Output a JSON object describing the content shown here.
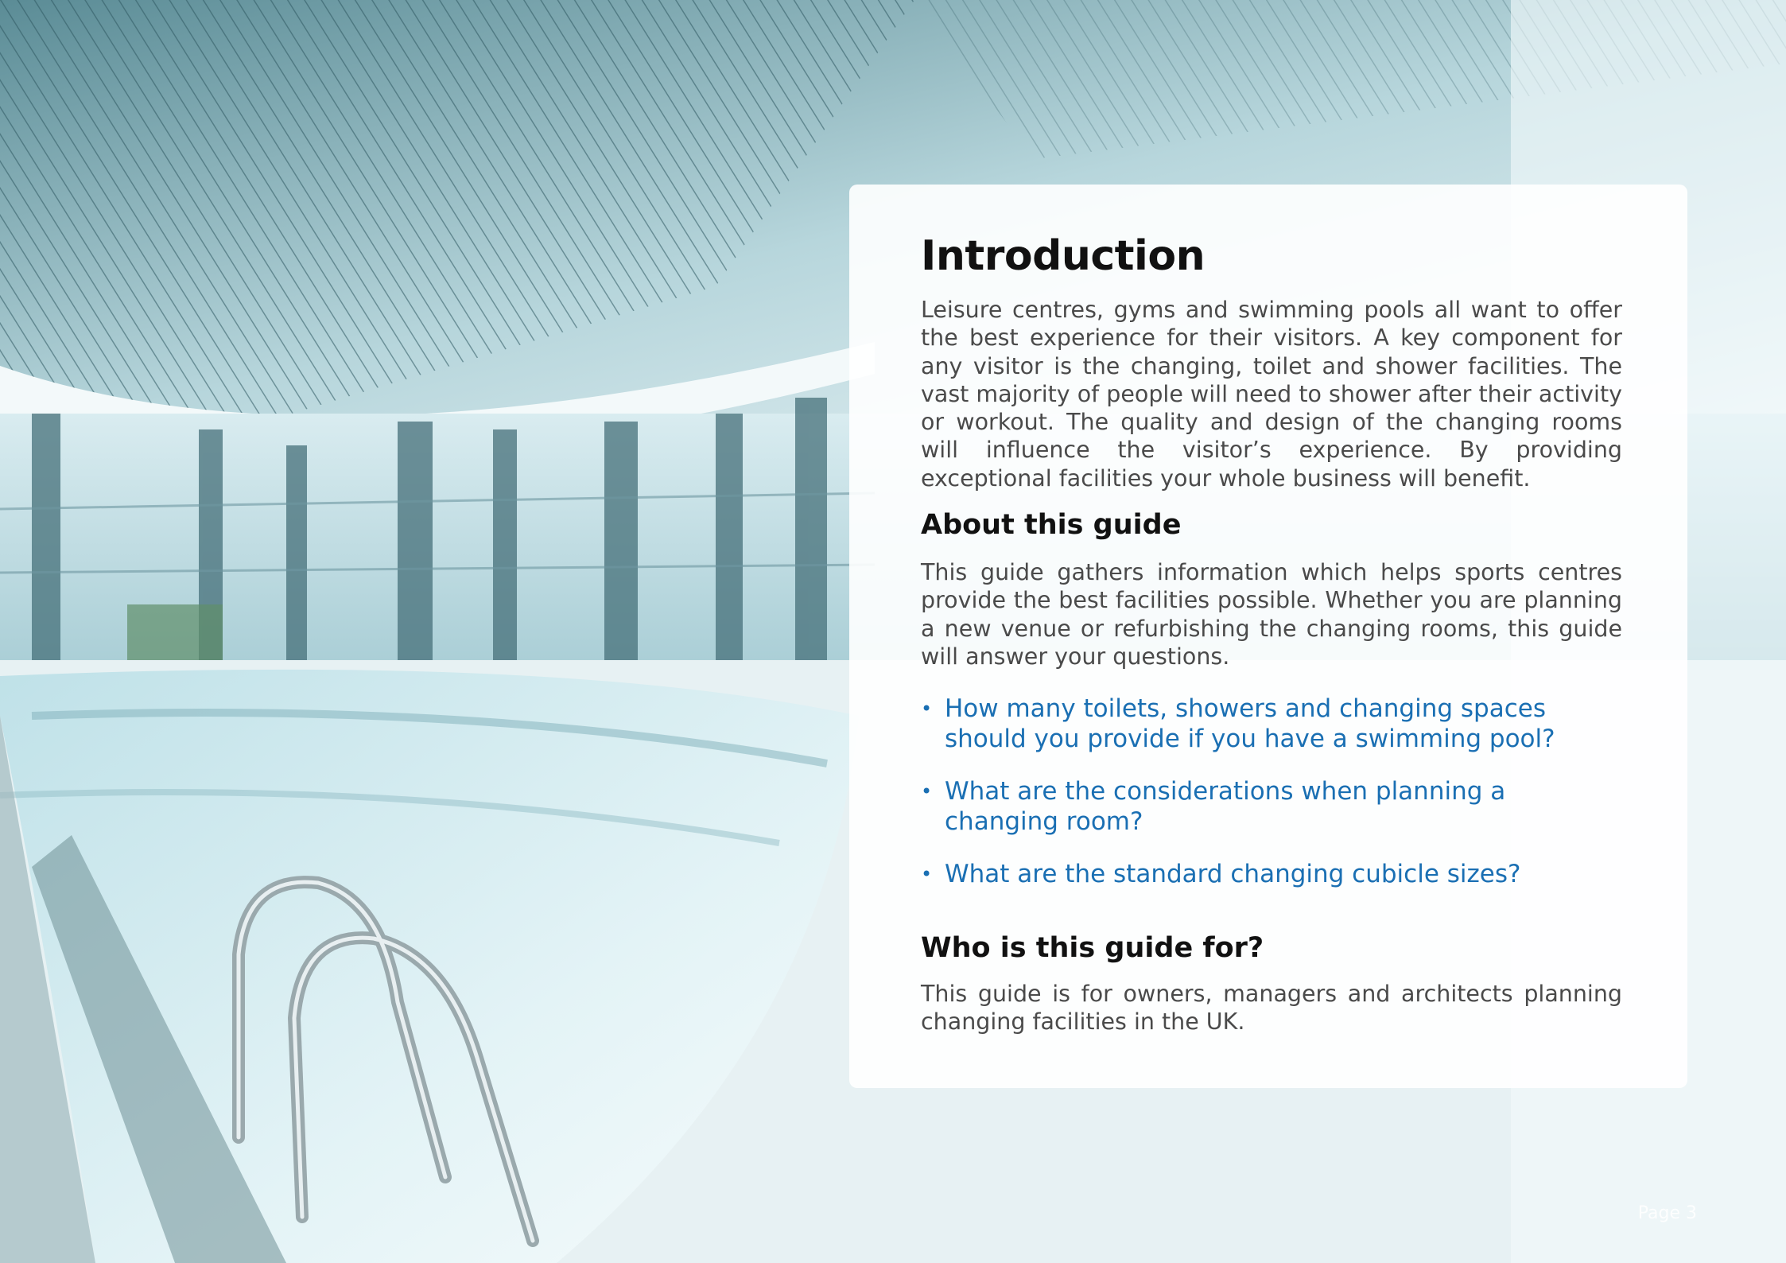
{
  "intro": {
    "title": "Introduction",
    "text": "Leisure centres, gyms and swimming pools all want to offer the best experience for their visitors. A key component for any visitor is the changing, toilet and shower facilities. The vast majority of people will need to shower after their activity or workout. The quality and design of the changing rooms will influence the visitor’s experience. By providing exceptional facilities your whole business will benefit."
  },
  "about": {
    "heading": "About this guide",
    "text": "This guide gathers information which helps sports centres provide the best facilities possible. Whether you are planning a new venue or refurbishing the changing rooms, this guide will answer your questions.",
    "questions": [
      "How many toilets, showers and changing spaces should you provide if you have a swimming pool?",
      "What are the considerations when planning a changing room?",
      "What are the standard changing cubicle sizes?"
    ]
  },
  "audience": {
    "heading": "Who is this guide for?",
    "text": "This guide is for owners, managers and architects planning changing facilities in the UK."
  },
  "page_label": "Page 3",
  "colors": {
    "link": "#1a6fb3",
    "heading": "#111111",
    "body": "#4a4a4a"
  }
}
